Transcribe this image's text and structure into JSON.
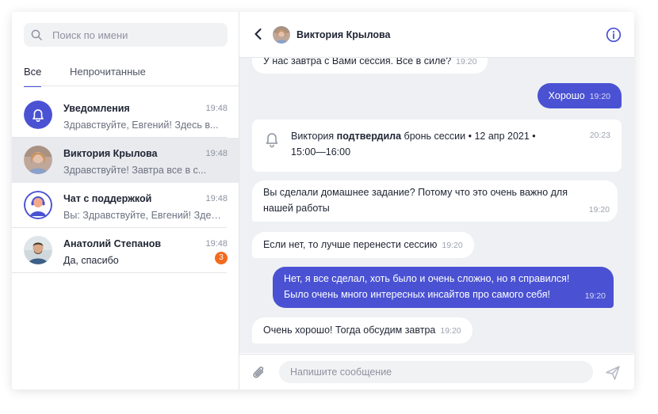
{
  "search": {
    "placeholder": "Поиск по имени"
  },
  "tabs": {
    "all": "Все",
    "unread": "Непрочитанные"
  },
  "chats": [
    {
      "name": "Уведомления",
      "time": "19:48",
      "preview": "Здравствуйте, Евгений! Здесь в..."
    },
    {
      "name": "Виктория Крылова",
      "time": "19:48",
      "preview": "Здравствуйте! Завтра все в с..."
    },
    {
      "name": "Чат с поддержкой",
      "time": "19:48",
      "preview": "Вы: Здравствуйте, Евгений! Здес..."
    },
    {
      "name": "Анатолий Степанов",
      "time": "19:48",
      "preview": "Да, спасибо",
      "unread": "3"
    }
  ],
  "header": {
    "name": "Виктория Крылова"
  },
  "messages": [
    {
      "text": "У нас завтра с Вами сессия. Все в силе?",
      "time": "19:20"
    },
    {
      "text": "Хорошо",
      "time": "19:20"
    },
    {
      "text": "Вы сделали домашнее задание? Потому что это очень важно для нашей работы",
      "time": "19:20"
    },
    {
      "text": "Если нет, то лучше перенести сессию",
      "time": "19:20"
    },
    {
      "text": "Нет, я все сделал, хоть было и очень сложно, но я справился! Было очень много интересных инсайтов про самого себя!",
      "time": "19:20"
    },
    {
      "text": "Очень хорошо! Тогда обсудим завтра",
      "time": "19:20"
    }
  ],
  "notice": {
    "actor": "Виктория",
    "action": "подтвердила",
    "rest": "бронь сессии • 12 апр 2021 • 15:00—16:00",
    "time": "20:23"
  },
  "composer": {
    "placeholder": "Напишите сообщение"
  },
  "colors": {
    "accent": "#4a52d3",
    "badge": "#f26b1d",
    "chat_bg": "#eef0f3"
  }
}
